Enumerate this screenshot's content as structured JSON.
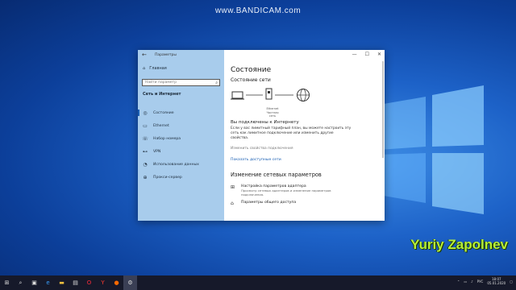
{
  "watermark": "www.BANDICAM.com",
  "author": "Yuriy Zapolnev",
  "window": {
    "title": "Параметры",
    "back_glyph": "←",
    "controls": [
      "—",
      "☐",
      "✕"
    ]
  },
  "sidebar": {
    "home": "Главная",
    "search_placeholder": "Найти параметр",
    "section": "Сеть и Интернет",
    "items": [
      {
        "label": "Состояние",
        "icon": "globe-icon",
        "glyph": "◎"
      },
      {
        "label": "Ethernet",
        "icon": "monitor-icon",
        "glyph": "▭"
      },
      {
        "label": "Набор номера",
        "icon": "phone-icon",
        "glyph": "☏"
      },
      {
        "label": "VPN",
        "icon": "vpn-icon",
        "glyph": "⊷"
      },
      {
        "label": "Использование данных",
        "icon": "data-usage-icon",
        "glyph": "◔"
      },
      {
        "label": "Прокси-сервер",
        "icon": "globe-icon",
        "glyph": "⊕"
      }
    ]
  },
  "content": {
    "title": "Состояние",
    "network_status": "Состояние сети",
    "ethernet_label": "Ethernet",
    "network_type": "Частная сеть",
    "connected": "Вы подключены к Интернету",
    "description": "Если у вас лимитный тарифный план, вы можете настроить эту сеть как лимитное подключение или изменить другие свойства.",
    "change_props": "Изменить свойства подключения",
    "show_networks": "Показать доступные сети",
    "change_section": "Изменение сетевых параметров",
    "adapter_title": "Настройка параметров адаптера",
    "adapter_desc": "Просмотр сетевых адаптеров и изменение параметров подключения.",
    "sharing_title": "Параметры общего доступа"
  },
  "taskbar": {
    "lang": "РУС",
    "time": "18:07",
    "date": "05.01.2020"
  },
  "colors": {
    "accent": "#1a5fb4",
    "sidebar_bg": "#a8ccec",
    "taskbar_bg": "#16192a",
    "author_text": "#b7f03a"
  }
}
